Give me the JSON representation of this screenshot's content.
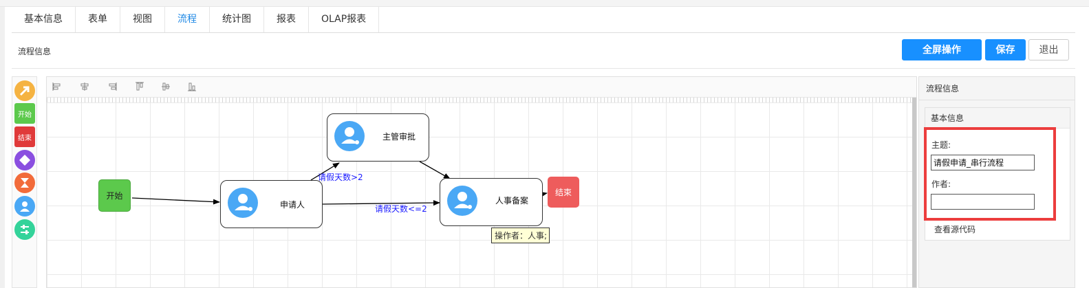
{
  "tabs": [
    {
      "label": "基本信息"
    },
    {
      "label": "表单"
    },
    {
      "label": "视图"
    },
    {
      "label": "流程"
    },
    {
      "label": "统计图"
    },
    {
      "label": "报表"
    },
    {
      "label": "OLAP报表"
    }
  ],
  "active_tab": "流程",
  "header": {
    "title": "流程信息",
    "fullscreen_label": "全屏操作",
    "save_label": "保存",
    "exit_label": "退出"
  },
  "palette": {
    "items": [
      {
        "icon": "arrow-tool-icon",
        "color": "#f5b342"
      },
      {
        "icon": "start-node-tool",
        "label": "开始",
        "color": "#5cc94c"
      },
      {
        "icon": "end-node-tool",
        "label": "结束",
        "color": "#e03a3a"
      },
      {
        "icon": "decision-diamond-icon",
        "color": "#8a4fe0"
      },
      {
        "icon": "hourglass-icon",
        "color": "#f26b3a"
      },
      {
        "icon": "user-task-icon",
        "color": "#4aa8f5"
      },
      {
        "icon": "settings-slider-icon",
        "color": "#34d39a"
      }
    ]
  },
  "diagram": {
    "nodes": {
      "start": "开始",
      "applicant": "申请人",
      "supervisor": "主管审批",
      "hr": "人事备案",
      "end": "结束"
    },
    "edges": {
      "gt2": "请假天数>2",
      "le2": "请假天数<=2"
    },
    "tooltip": "操作者：人事;"
  },
  "right_panel": {
    "title": "流程信息",
    "section_title": "基本信息",
    "subject_label": "主题:",
    "subject_value": "请假申请_串行流程",
    "author_label": "作者:",
    "author_value": "",
    "view_source": "查看源代码"
  }
}
